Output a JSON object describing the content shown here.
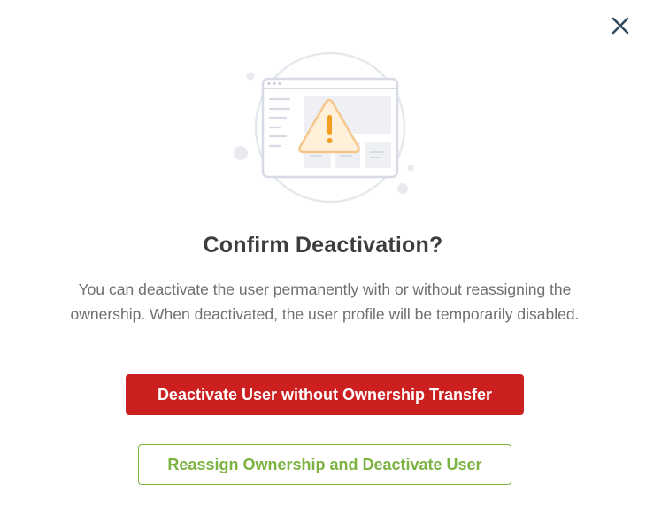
{
  "dialog": {
    "title": "Confirm Deactivation?",
    "message": "You can deactivate the user permanently with or without reassigning the ownership. When deactivated, the user profile will be temporarily disabled.",
    "primary_button": "Deactivate User without Ownership Transfer",
    "secondary_button": "Reassign Ownership and Deactivate User"
  },
  "icons": {
    "close": "close-icon",
    "illustration": "warning-browser-illustration"
  },
  "colors": {
    "danger": "#cc1f1f",
    "success": "#7cb342",
    "title": "#3d3d3d",
    "text": "#6f6f6f",
    "close": "#2f4a5e"
  }
}
